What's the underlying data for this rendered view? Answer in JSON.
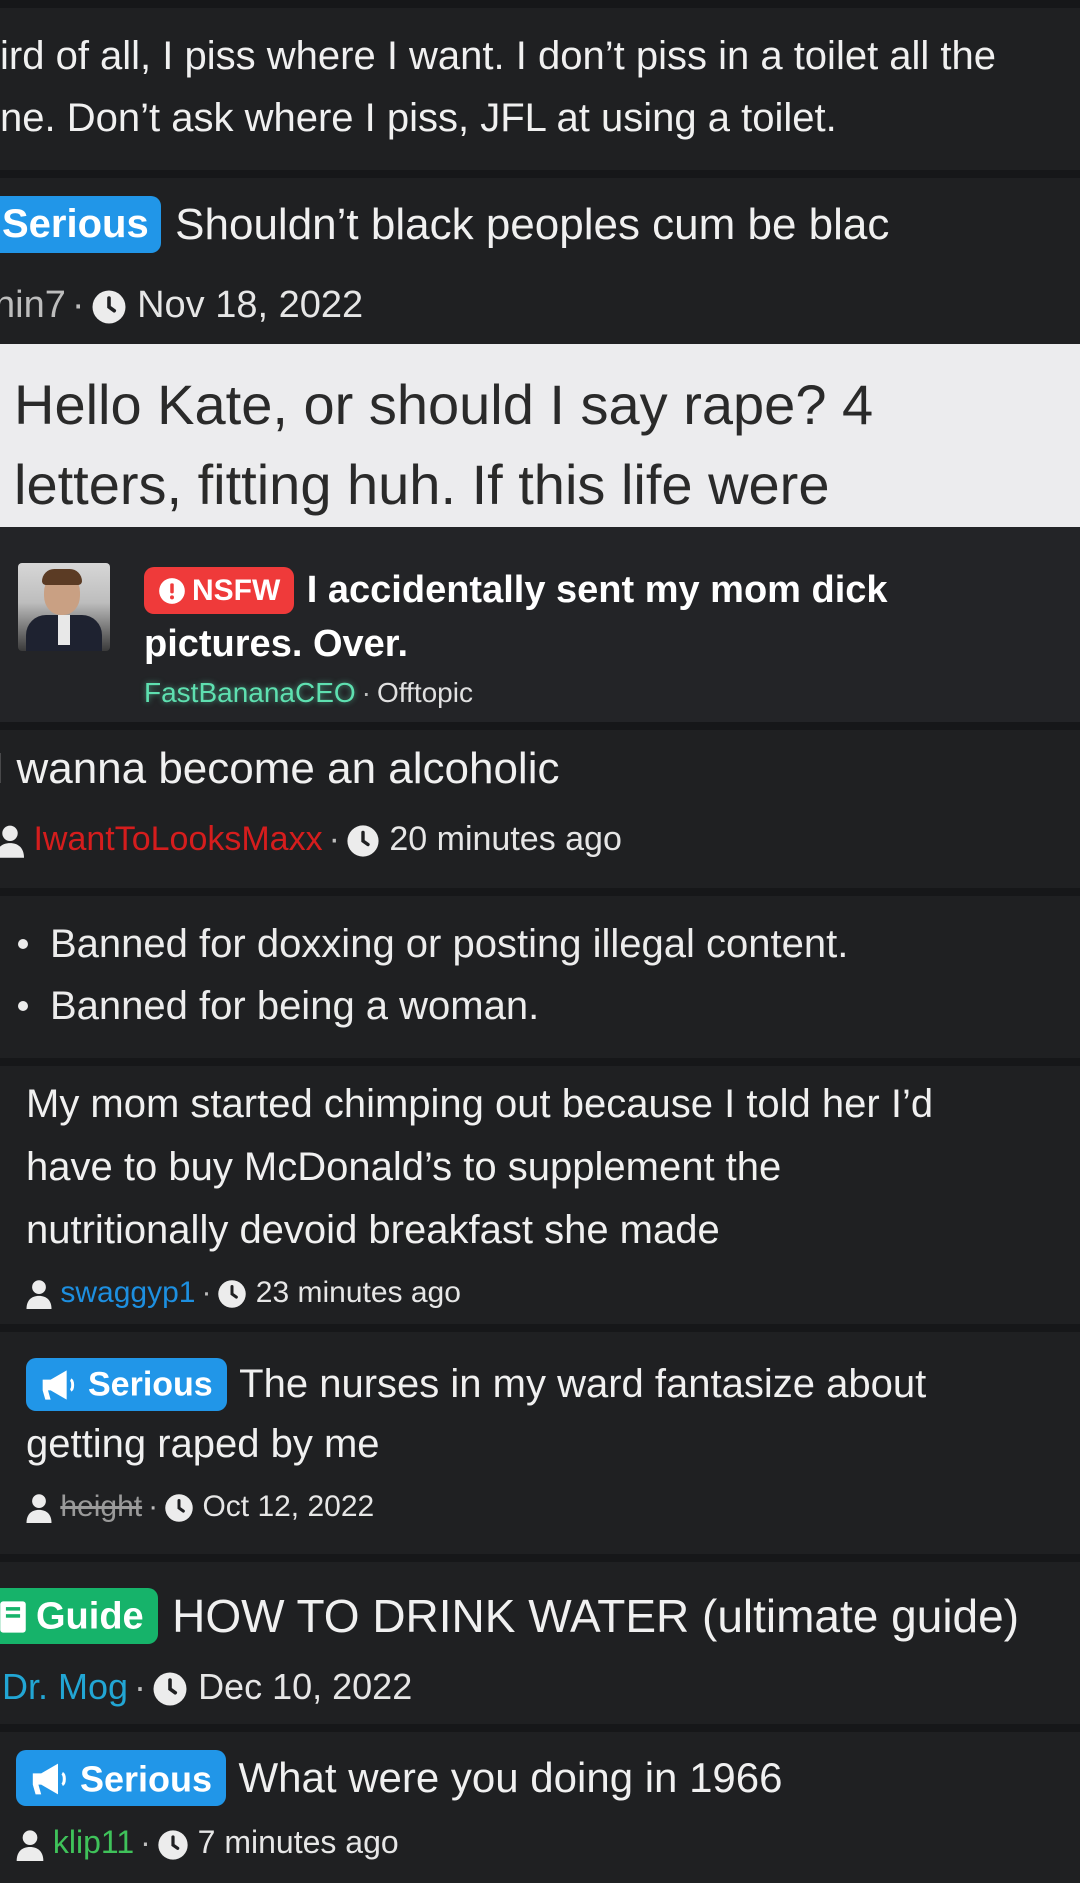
{
  "colors": {
    "background": "#1f2022",
    "tag_serious": "#2196e8",
    "tag_guide": "#16b36a",
    "tag_nsfw": "#ef3a3a"
  },
  "card1": {
    "line1": "ird of all, I piss where I want. I don’t piss in a toilet all the",
    "line2": "ne. Don’t ask where I piss, JFL at using a toilet."
  },
  "card2": {
    "tag": "Serious",
    "title": "Shouldn’t black peoples cum be blac",
    "author": "nin7",
    "date": "Nov 18, 2022"
  },
  "card3": {
    "line1": "Hello Kate, or should I say rape? 4",
    "line2": "letters, fitting huh. If this life were"
  },
  "card4": {
    "tag": "NSFW",
    "title_line1": "I accidentally sent my mom dick",
    "title_line2": "pictures. Over.",
    "author": "FastBananaCEO",
    "forum": "Offtopic"
  },
  "card5": {
    "title": "I wanna become an alcoholic",
    "author": "IwantToLooksMaxx",
    "time": "20 minutes ago"
  },
  "card6": {
    "items": [
      "Banned for doxxing or posting illegal content.",
      "Banned for being a woman."
    ]
  },
  "card7": {
    "line1": "My mom started chimping out because I told her I’d",
    "line2": "have to buy McDonald’s to supplement the",
    "line3": "nutritionally devoid breakfast she made",
    "author": "swaggyp1",
    "time": "23 minutes ago"
  },
  "card8": {
    "tag": "Serious",
    "title_line1": "The nurses in my ward fantasize about",
    "title_line2": "getting raped by me",
    "author": "height",
    "date": "Oct 12, 2022"
  },
  "card9": {
    "tag": "Guide",
    "title": "HOW TO DRINK WATER (ultimate guide)",
    "author": "Dr. Mog",
    "date": "Dec 10, 2022"
  },
  "card10": {
    "tag": "Serious",
    "title": "What were you doing in 1966",
    "author": "klip11",
    "time": "7 minutes ago"
  }
}
